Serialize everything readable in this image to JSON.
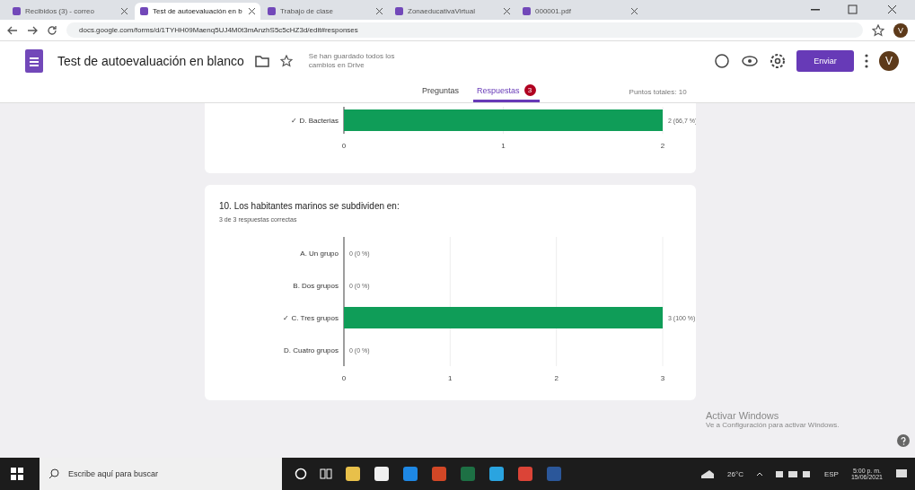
{
  "browser": {
    "tabs": [
      {
        "title": "Recibidos (3) - correo",
        "selected": false
      },
      {
        "title": "Test de autoevaluación en b",
        "selected": true
      },
      {
        "title": "Trabajo de clase",
        "selected": false
      },
      {
        "title": "ZonaeducativaVirtual",
        "selected": false
      },
      {
        "title": "000001.pdf",
        "selected": false
      }
    ],
    "url": "docs.google.com/forms/d/1TYHH09Maenq5UJ4M0t3mAnzhS5c5cHZ3d/edit#responses",
    "avatar": "V"
  },
  "form": {
    "title": "Test de autoevaluación en blanco",
    "save_status": "Se han guardado todos los cambios en Drive",
    "send_button": "Enviar",
    "avatar": "V",
    "tabs": [
      {
        "label": "Preguntas",
        "selected": false
      },
      {
        "label": "Respuestas",
        "selected": true,
        "badge": "3"
      }
    ],
    "total_points": "Puntos totales: 10"
  },
  "questions": [
    {
      "chart_data": {
        "type": "bar",
        "orientation": "horizontal",
        "categories": [
          "✓ D. Bacterias"
        ],
        "values": [
          2
        ],
        "value_labels": [
          "2 (66,7 %)"
        ],
        "xlim": [
          0,
          2
        ],
        "xticks": [
          0,
          1,
          2
        ]
      }
    },
    {
      "title": "10. Los habitantes marinos se subdividen en:",
      "summary": "3 de 3 respuestas correctas",
      "chart_data": {
        "type": "bar",
        "orientation": "horizontal",
        "categories": [
          "A. Un grupo",
          "B. Dos grupos",
          "✓ C. Tres grupos",
          "D. Cuatro grupos"
        ],
        "values": [
          0,
          0,
          3,
          0
        ],
        "value_labels": [
          "0 (0 %)",
          "0 (0 %)",
          "3 (100 %)",
          "0 (0 %)"
        ],
        "xlim": [
          0,
          3
        ],
        "xticks": [
          0,
          1,
          2,
          3
        ]
      }
    }
  ],
  "windows_notice": {
    "title": "Activar Windows",
    "text": "Ve a Configuración para activar Windows."
  },
  "taskbar": {
    "search_placeholder": "Escribe aquí para buscar",
    "weather": "26°C",
    "language": "ESP",
    "time": "5:00 p. m.",
    "date": "15/06/2021"
  }
}
